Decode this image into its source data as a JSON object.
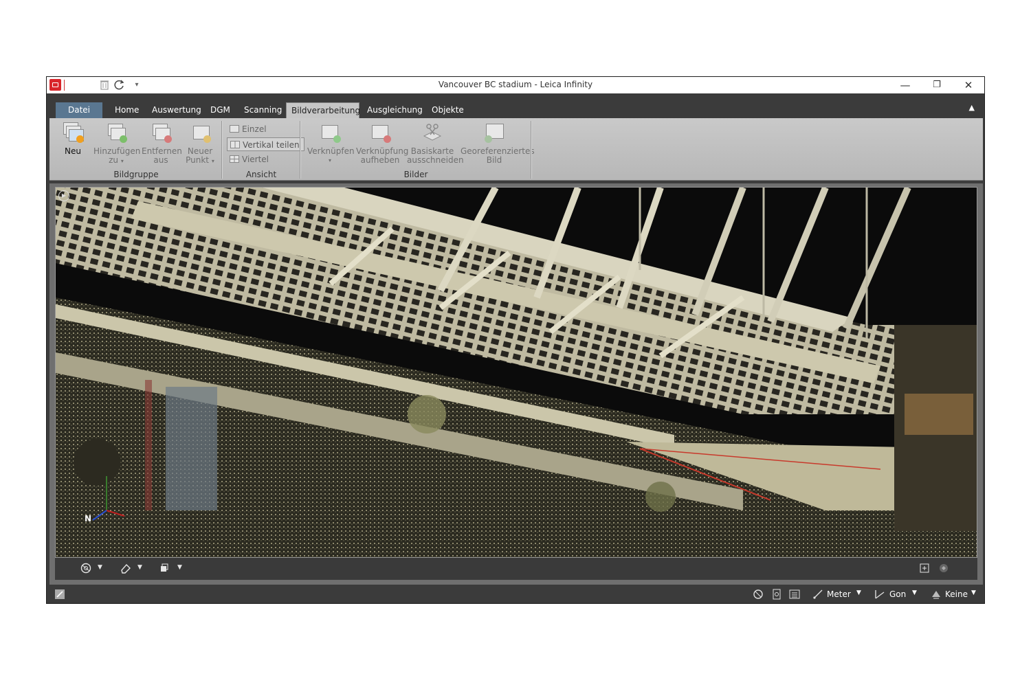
{
  "window": {
    "title": "Vancouver BC stadium - Leica Infinity"
  },
  "quick_access": [
    {
      "icon": "delete-icon"
    },
    {
      "icon": "redo-icon"
    },
    {
      "icon": "customize-dropdown-icon"
    }
  ],
  "tabs": [
    {
      "label": "Datei"
    },
    {
      "label": "Home"
    },
    {
      "label": "Auswertung"
    },
    {
      "label": "DGM"
    },
    {
      "label": "Scanning"
    },
    {
      "label": "Bildverarbeitung"
    },
    {
      "label": "Ausgleichung"
    },
    {
      "label": "Objekte"
    }
  ],
  "active_tab": "Bildverarbeitung",
  "ribbon": {
    "groups": [
      {
        "label": "Bildgruppe"
      },
      {
        "label": "Ansicht"
      },
      {
        "label": "Bilder"
      }
    ],
    "bildgruppe": {
      "neu": "Neu",
      "hinzufuegen_line1": "Hinzufügen",
      "hinzufuegen_line2": "zu",
      "entfernen_line1": "Entfernen",
      "entfernen_line2": "aus",
      "neuer_punkt_line1": "Neuer",
      "neuer_punkt_line2": "Punkt"
    },
    "ansicht": {
      "einzel": "Einzel",
      "vertikal": "Vertikal teilen",
      "viertel": "Viertel"
    },
    "bilder": {
      "verknuepfen": "Verknüpfen",
      "verknuepfung_line1": "Verknüpfung",
      "verknuepfung_line2": "aufheben",
      "basiskarte_line1": "Basiskarte",
      "basiskarte_line2": "ausschneiden",
      "georef_line1": "Georeferenziertes",
      "georef_line2": "Bild"
    }
  },
  "viewport": {
    "content": "point-cloud-stadium",
    "axis_label": "N"
  },
  "statusbar": {
    "units_distance": "Meter",
    "units_angle": "Gon",
    "coordinate_system": "Keine"
  },
  "colors": {
    "tab_file": "#5a7791",
    "chrome_dark": "#3b3b3b",
    "ribbon_bg": "#c0c0c0",
    "point_cloud_bg": "#0b0b0b"
  }
}
